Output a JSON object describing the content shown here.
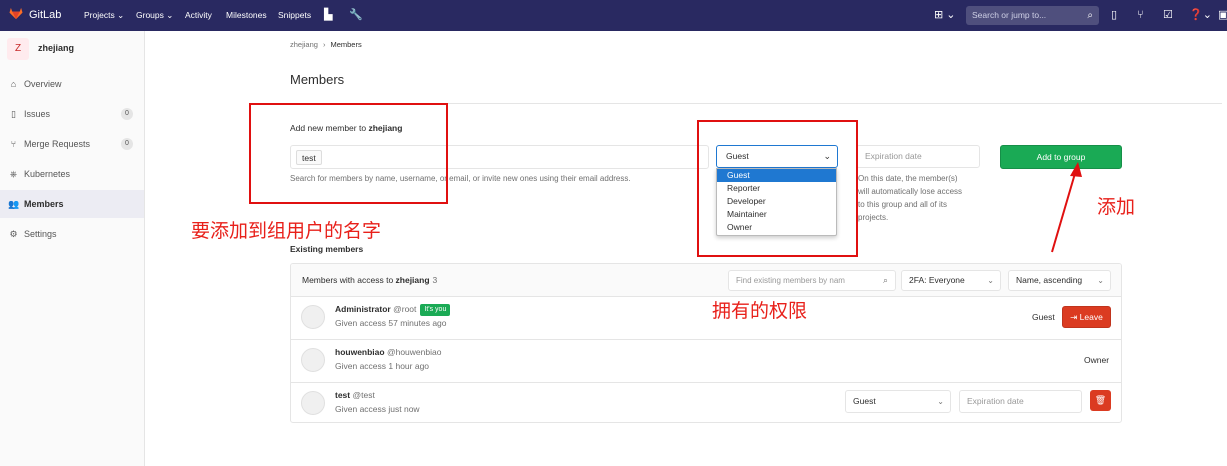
{
  "topbar": {
    "brand": "GitLab",
    "nav": [
      "Projects ⌄",
      "Groups ⌄",
      "Activity",
      "Milestones",
      "Snippets"
    ],
    "search_placeholder": "Search or jump to...",
    "colors": {
      "bg": "#292961",
      "logo": "#fc6d26"
    }
  },
  "sidebar": {
    "context": {
      "avatar_letter": "Z",
      "name": "zhejiang"
    },
    "items": [
      {
        "label": "Overview",
        "icon": "home-icon"
      },
      {
        "label": "Issues",
        "icon": "issues-icon",
        "badge": "0"
      },
      {
        "label": "Merge Requests",
        "icon": "merge-request-icon",
        "badge": "0"
      },
      {
        "label": "Kubernetes",
        "icon": "kubernetes-icon"
      },
      {
        "label": "Members",
        "icon": "users-icon",
        "active": true
      },
      {
        "label": "Settings",
        "icon": "gear-icon"
      }
    ]
  },
  "breadcrumb": {
    "group": "zhejiang",
    "sep": "›",
    "current": "Members"
  },
  "page_title": "Members",
  "add_member": {
    "label_prefix": "Add new member to ",
    "group": "zhejiang",
    "token": "test",
    "help": "Search for members by name, username, or email, or invite new ones using their email address.",
    "role_selected": "Guest",
    "role_options": [
      "Guest",
      "Reporter",
      "Developer",
      "Maintainer",
      "Owner"
    ],
    "expiration_placeholder": "Expiration date",
    "expiration_help_lines": [
      "On this date, the member(s)",
      "will automatically lose access",
      "to this group and all of its",
      "projects."
    ],
    "add_button": "Add to group"
  },
  "existing": {
    "title": "Existing members",
    "header_prefix": "Members with access to ",
    "group": "zhejiang",
    "count": "3",
    "filter_placeholder": "Find existing members by nam",
    "twofa": "2FA: Everyone",
    "sort": "Name, ascending",
    "members": [
      {
        "name": "Administrator",
        "handle": "@root",
        "badge": "It's you",
        "given": "Given access 57 minutes ago",
        "role": "Guest",
        "action": "Leave"
      },
      {
        "name": "houwenbiao",
        "handle": "@houwenbiao",
        "given": "Given access 1 hour ago",
        "role": "Owner"
      },
      {
        "name": "test",
        "handle": "@test",
        "given": "Given access just now",
        "role": "Guest",
        "expiration_placeholder": "Expiration date"
      }
    ]
  },
  "annotations": {
    "name_note": "要添加到组用户的名字",
    "role_note": "拥有的权限",
    "add_note": "添加",
    "color": "#e01010"
  }
}
